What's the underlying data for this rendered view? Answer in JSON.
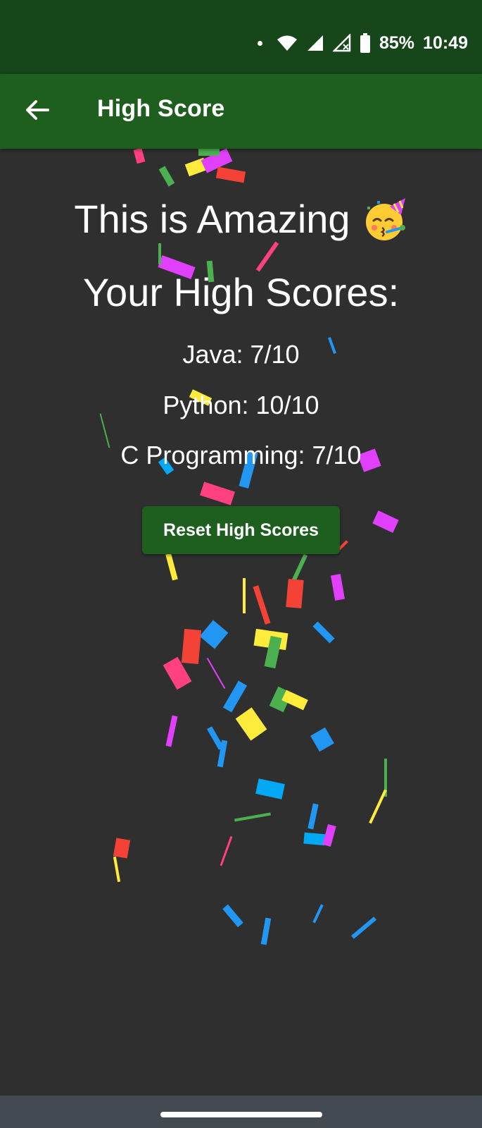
{
  "status_bar": {
    "battery": "85%",
    "time": "10:49",
    "icons": [
      "notification-dot-icon",
      "wifi-icon",
      "signal-icon",
      "signal-no-service-icon",
      "battery-icon"
    ]
  },
  "app_bar": {
    "title": "High Score",
    "back_icon": "arrow-left-icon"
  },
  "main": {
    "headline": "This is Amazing",
    "headline_emoji": "partying-face-emoji",
    "subheading": "Your High Scores:",
    "scores": [
      {
        "label": "Java: 7/10"
      },
      {
        "label": "Python: 10/10"
      },
      {
        "label": "C Programming: 7/10"
      }
    ],
    "reset_label": "Reset High Scores"
  },
  "colors": {
    "status_bar": "#17461a",
    "app_bar": "#1e5e1f",
    "background": "#2f2f2f",
    "nav_bar": "#434a52",
    "confetti": [
      "#f44336",
      "#2196f3",
      "#ffeb3b",
      "#4caf50",
      "#e040fb",
      "#ff4081",
      "#03a9f4"
    ]
  }
}
